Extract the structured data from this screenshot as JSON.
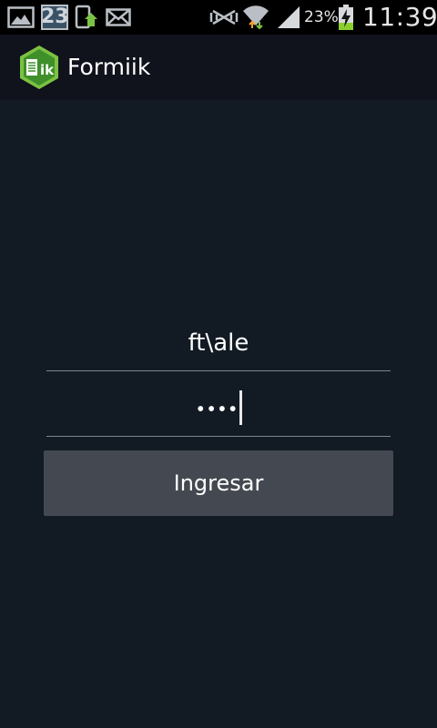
{
  "status_bar": {
    "notification_icons": [
      "gallery-icon",
      "calendar-icon",
      "phone-upload-icon",
      "email-icon"
    ],
    "calendar_day": "23",
    "system_icons": [
      "nfc-icon",
      "wifi-icon",
      "signal-icon",
      "battery-charging-icon"
    ],
    "battery_percent": "23%",
    "time": "11:39"
  },
  "action_bar": {
    "logo_icon": "formiik-logo-icon",
    "title": "Formiik"
  },
  "login": {
    "username_value": "ft\\ale",
    "password_mask": "••••",
    "submit_label": "Ingresar"
  },
  "colors": {
    "background": "#121a23",
    "action_bar": "#10121c",
    "status_bar": "#000000",
    "button": "#444951",
    "divider": "#7d848b",
    "logo_green": "#7cc242",
    "battery_green": "#8bcf2e"
  }
}
